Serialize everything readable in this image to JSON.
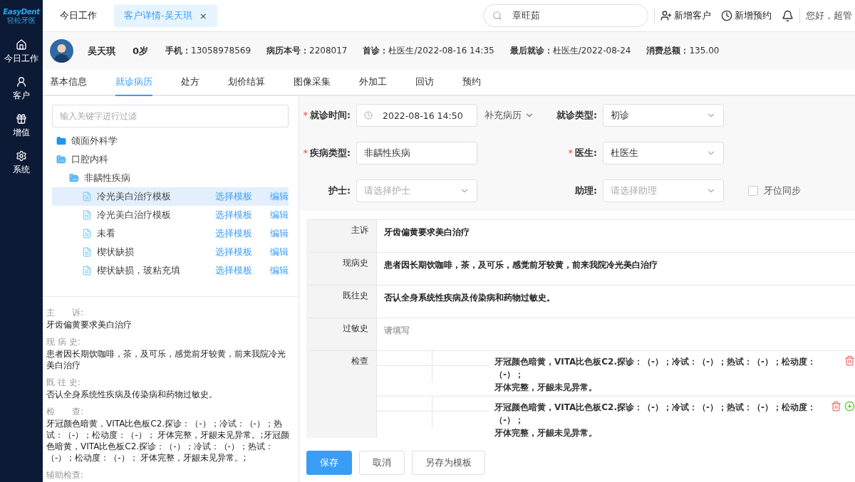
{
  "brand": {
    "logo": "EasyDent",
    "subtitle": "轻松牙医"
  },
  "nav": [
    {
      "label": "今日工作"
    },
    {
      "label": "客户"
    },
    {
      "label": "增值"
    },
    {
      "label": "系统"
    }
  ],
  "page_tabs": [
    {
      "label": "今日工作",
      "selected": false
    },
    {
      "label": "客户详情-吴天琪",
      "selected": true,
      "close": "×"
    }
  ],
  "search": {
    "value": "章旺茹"
  },
  "actions": [
    {
      "label": "新增客户"
    },
    {
      "label": "新增预约"
    }
  ],
  "greeting": "您好，超管",
  "patient": {
    "name": "吴天琪",
    "age": "0岁",
    "fields": [
      {
        "label": "手机：",
        "value": "13058978569"
      },
      {
        "label": "病历本号：",
        "value": "2208017"
      },
      {
        "label": "首诊：",
        "value": "杜医生/2022-08-16 14:35"
      },
      {
        "label": "最后就诊：",
        "value": "杜医生/2022-08-24"
      },
      {
        "label": "消费总额：",
        "value": "135.00"
      }
    ]
  },
  "tabs": [
    {
      "label": "基本信息",
      "selected": false
    },
    {
      "label": "就诊病历",
      "selected": true
    },
    {
      "label": "处方",
      "selected": false
    },
    {
      "label": "划价结算",
      "selected": false
    },
    {
      "label": "图像采集",
      "selected": false
    },
    {
      "label": "外加工",
      "selected": false
    },
    {
      "label": "回访",
      "selected": false
    },
    {
      "label": "预约",
      "selected": false
    }
  ],
  "filter": {
    "placeholder": "输入关键字进行过滤"
  },
  "tree": [
    {
      "kind": "folder",
      "label": "颌面外科学",
      "expanded": false
    },
    {
      "kind": "folder",
      "label": "口腔内科",
      "expanded": true,
      "children": [
        {
          "kind": "folder",
          "label": "非龋性疾病",
          "expanded": true,
          "children": [
            {
              "kind": "template",
              "label": "冷光美白治疗模板",
              "selected": true,
              "select": "选择模板",
              "edit": "编辑"
            },
            {
              "kind": "template",
              "label": "冷光美白治疗模板",
              "selected": false,
              "select": "选择模板",
              "edit": "编辑"
            },
            {
              "kind": "template",
              "label": "未看",
              "selected": false,
              "select": "选择模板",
              "edit": "编辑"
            },
            {
              "kind": "template",
              "label": "楔状缺损",
              "selected": false,
              "select": "选择模板",
              "edit": "编辑"
            },
            {
              "kind": "template",
              "label": "楔状缺损，玻粘充填",
              "selected": false,
              "select": "选择模板",
              "edit": "编辑"
            }
          ]
        }
      ]
    }
  ],
  "summary": [
    {
      "label": "主　　诉:",
      "text": "牙齿偏黄要求美白治疗"
    },
    {
      "label": "现 病 史:",
      "text": "患者因长期饮咖啡，茶，及可乐，感觉前牙较黄，前来我院冷光美白治疗"
    },
    {
      "label": "既 往 史:",
      "text": "否认全身系统性疾病及传染病和药物过敏史。"
    },
    {
      "label": "检　　查:",
      "text": "牙冠颜色暗黄，VITA比色板C2.探诊：（-）；冷试：（-）；热试：（-）；松动度：（-）； 牙体完整，牙龈未见异常。;牙冠颜色暗黄，VITA比色板C2.探诊：（-）；冷试：（-）；热试：（-）；松动度：（-）； 牙体完整，牙龈未见异常。;"
    },
    {
      "label": "辅助检查:"
    }
  ],
  "form": {
    "visit_time": {
      "mark": "*",
      "label": "就诊时间:",
      "value": "2022-08-16 14:50"
    },
    "supplement": {
      "label": "补充病历"
    },
    "visit_type": {
      "label": "就诊类型:",
      "value": "初诊"
    },
    "disease_type": {
      "mark": "*",
      "label": "疾病类型:",
      "value": "非龋性疾病"
    },
    "doctor": {
      "mark": "*",
      "label": "医生:",
      "value": "杜医生"
    },
    "nurse": {
      "label": "护士:",
      "placeholder": "请选择护士"
    },
    "assistant": {
      "label": "助理:",
      "placeholder": "请选择助理"
    },
    "tooth_sync": {
      "label": "牙位同步",
      "checked": false
    }
  },
  "record": [
    {
      "kind": "text",
      "label": "主诉",
      "value": "牙齿偏黄要求美白治疗"
    },
    {
      "kind": "text",
      "label": "现病史",
      "value": "患者因长期饮咖啡，茶，及可乐，感觉前牙较黄，前来我院冷光美白治疗"
    },
    {
      "kind": "text",
      "label": "既往史",
      "value": "否认全身系统性疾病及传染病和药物过敏史。"
    },
    {
      "kind": "text",
      "label": "过敏史",
      "placeholder": "请填写"
    },
    {
      "kind": "exam",
      "label": "检查",
      "entries": [
        {
          "lines": [
            "牙冠颜色暗黄，VITA比色板C2.探诊：（-）；冷试：（-）；热试：（-）；松动度：（-）；",
            "牙体完整，牙龈未见异常。"
          ],
          "addable": false
        },
        {
          "lines": [
            "牙冠颜色暗黄，VITA比色板C2.探诊：（-）；冷试：（-）；热试：（-）；松动度：（-）；",
            "牙体完整，牙龈未见异常。"
          ],
          "addable": true
        }
      ]
    }
  ],
  "buttons": [
    {
      "label": "保存",
      "primary": true
    },
    {
      "label": "取消",
      "primary": false
    },
    {
      "label": "另存为模板",
      "primary": false
    }
  ]
}
